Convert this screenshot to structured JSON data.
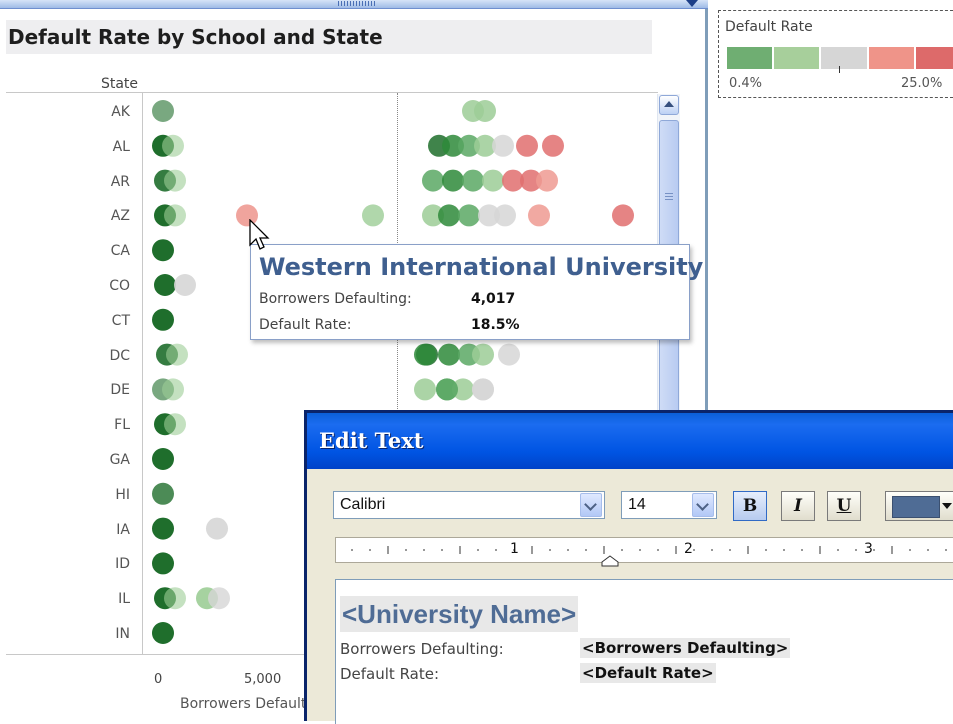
{
  "worksheet": {
    "title": "Default Rate by School and State",
    "state_header": "State",
    "x_axis_title": "Borrowers Defaulting",
    "x_ticks": [
      "0",
      "5,000"
    ]
  },
  "states": [
    "AK",
    "AL",
    "AR",
    "AZ",
    "CA",
    "CO",
    "CT",
    "DC",
    "DE",
    "FL",
    "GA",
    "HI",
    "IA",
    "ID",
    "IL",
    "IN"
  ],
  "legend": {
    "title": "Default Rate",
    "min_label": "0.4%",
    "max_label": "25.0%",
    "colors": [
      "#6fae72",
      "#a7cf9b",
      "#d6d6d6",
      "#ef9489",
      "#dd6a6a"
    ]
  },
  "tooltip": {
    "title": "Western International University",
    "rows": [
      {
        "label": "Borrowers Defaulting:",
        "value": "4,017"
      },
      {
        "label": "Default Rate:",
        "value": "18.5%"
      }
    ]
  },
  "edit_dialog": {
    "title": "Edit Text",
    "font_name": "Calibri",
    "font_size": "14",
    "bold_label": "B",
    "italic_label": "I",
    "underline_label": "U",
    "text_color": "#4f6c95",
    "ruler_numbers": [
      "1",
      "2",
      "3"
    ],
    "content": {
      "title_field": "<University Name>",
      "rows": [
        {
          "label": "Borrowers Defaulting:",
          "value": "<Borrowers Defaulting>"
        },
        {
          "label": "Default Rate:",
          "value": "<Default Rate>"
        }
      ]
    }
  }
}
